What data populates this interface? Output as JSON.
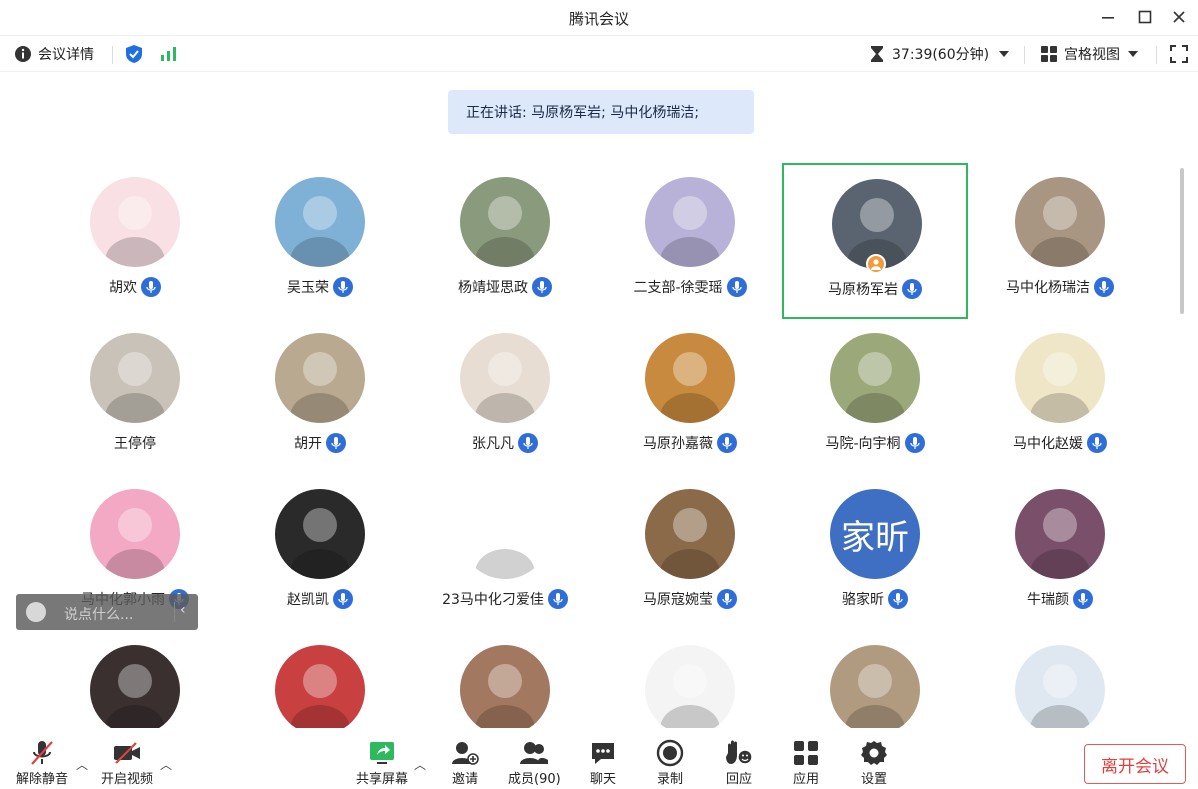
{
  "window": {
    "title": "腾讯会议"
  },
  "toolbar": {
    "meeting_details": "会议详情",
    "timer": "37:39(60分钟)",
    "view_mode": "宫格视图"
  },
  "speaking_banner": "正在讲话: 马原杨军岩; 马中化杨瑞洁;",
  "participants": [
    {
      "name": "胡欢",
      "avatar": "cartoon-girl-red",
      "color": "#f8e0e4"
    },
    {
      "name": "吴玉荣",
      "avatar": "photo-sunglasses",
      "color": "#7fb0d6"
    },
    {
      "name": "杨靖垭思政",
      "avatar": "photo-woman-hat",
      "color": "#8a9a7c"
    },
    {
      "name": "二支部-徐雯瑶",
      "avatar": "anime-girl",
      "color": "#b9b2d8"
    },
    {
      "name": "马原杨军岩",
      "avatar": "photo-piglet",
      "color": "#5a6470",
      "active": true,
      "host": true
    },
    {
      "name": "马中化杨瑞洁",
      "avatar": "photo-beach",
      "color": "#a89582"
    },
    {
      "name": "王停停",
      "avatar": "photo-cat",
      "color": "#c9c2b8",
      "muted": true
    },
    {
      "name": "胡开",
      "avatar": "photo-field",
      "color": "#b8a990"
    },
    {
      "name": "张凡凡",
      "avatar": "anime-woman",
      "color": "#e8ddd2"
    },
    {
      "name": "马原孙嘉薇",
      "avatar": "photo-dog",
      "color": "#c88a3e"
    },
    {
      "name": "马院-向宇桐",
      "avatar": "photo-girl-grass",
      "color": "#9aa87a"
    },
    {
      "name": "马中化赵媛",
      "avatar": "cartoon-shinchan",
      "color": "#efe6c8"
    },
    {
      "name": "马中化郭小雨",
      "avatar": "cartoon-bunny",
      "color": "#f3a9c4"
    },
    {
      "name": "赵凯凯",
      "avatar": "photo-astronaut",
      "color": "#2a2a2a"
    },
    {
      "name": "23马中化刁爱佳",
      "avatar": "cartoon-rainbow",
      "color": "#ffffff"
    },
    {
      "name": "马原寇婉莹",
      "avatar": "photo-flowers",
      "color": "#8b6a4a"
    },
    {
      "name": "骆家昕",
      "avatar": "text",
      "avatar_text": "家昕",
      "color": "#3e6fc2"
    },
    {
      "name": "牛瑞颜",
      "avatar": "photo-girl-pink",
      "color": "#7a4f6a"
    },
    {
      "name": "",
      "avatar": "photo-dark-woman",
      "color": "#3a3030"
    },
    {
      "name": "",
      "avatar": "photo-toy-rabbit",
      "color": "#c84040"
    },
    {
      "name": "",
      "avatar": "photo-woman-desk",
      "color": "#a37860"
    },
    {
      "name": "",
      "avatar": "sketch-letter",
      "color": "#f4f4f4"
    },
    {
      "name": "",
      "avatar": "photo-cat-sleep",
      "color": "#b09a80"
    },
    {
      "name": "",
      "avatar": "cartoon-rabbit-white",
      "color": "#dfe8f0"
    }
  ],
  "chat_float": {
    "placeholder": "说点什么..."
  },
  "bottom": {
    "unmute": "解除静音",
    "start_video": "开启视频",
    "share_screen": "共享屏幕",
    "invite": "邀请",
    "members": "成员(90)",
    "chat": "聊天",
    "record": "录制",
    "react": "回应",
    "apps": "应用",
    "settings": "设置",
    "leave": "离开会议"
  },
  "colors": {
    "accent": "#2f6ed9",
    "green": "#2dba5f",
    "danger": "#e04040",
    "banner": "#dde9fb"
  }
}
